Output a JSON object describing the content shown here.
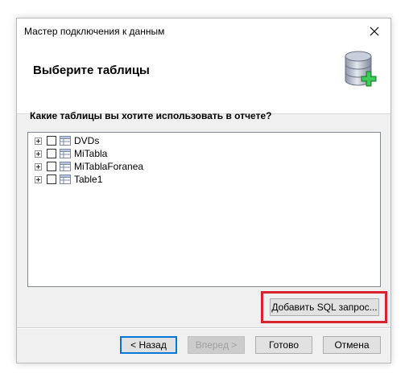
{
  "window": {
    "title": "Мастер подключения к данным"
  },
  "header": {
    "title": "Выберите таблицы",
    "icon": "database-add-icon"
  },
  "question": "Какие таблицы вы хотите использовать в отчете?",
  "tables": [
    {
      "label": "DVDs",
      "checked": false
    },
    {
      "label": "MiTabla",
      "checked": false
    },
    {
      "label": "MiTablaForanea",
      "checked": false
    },
    {
      "label": "Table1",
      "checked": false
    }
  ],
  "buttons": {
    "add_sql": "Добавить SQL запрос...",
    "back": "< Назад",
    "next": "Вперед >",
    "done": "Готово",
    "cancel": "Отмена"
  },
  "colors": {
    "highlight": "#d9232e",
    "accent": "#0078d7",
    "plus": "#2fb34a"
  }
}
